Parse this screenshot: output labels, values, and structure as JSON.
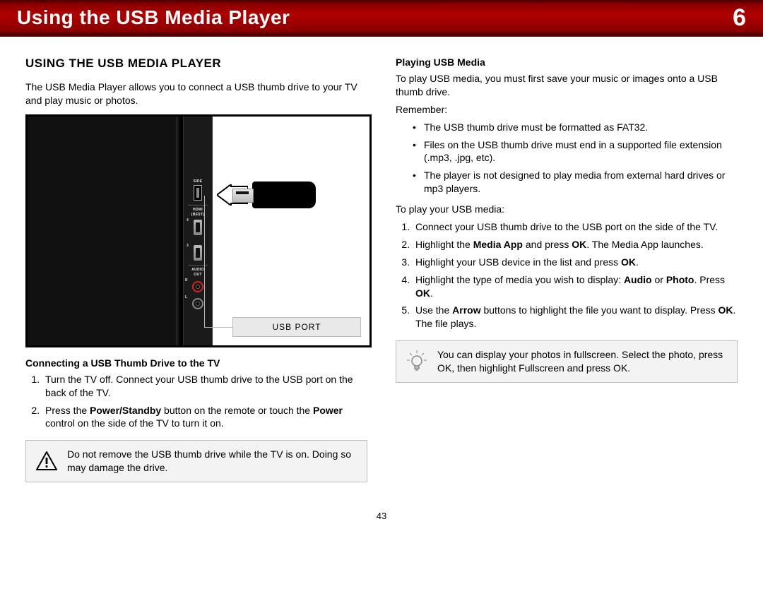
{
  "banner": {
    "title": "Using the USB Media Player",
    "chapter": "6"
  },
  "left": {
    "heading": "USING THE USB MEDIA PLAYER",
    "intro": "The USB Media Player allows you to connect a USB thumb drive to your TV and play music or photos.",
    "figure": {
      "side_label": "SIDE",
      "hdmi_label_1": "HDMI",
      "hdmi_label_2": "(BEST)",
      "audio_label_1": "AUDIO",
      "audio_label_2": "OUT",
      "port4": "4",
      "port3": "3",
      "r": "R",
      "l": "L",
      "callout_label": "USB PORT"
    },
    "sub_heading": "Connecting a USB Thumb Drive to the TV",
    "step1": "Turn the TV off. Connect your USB thumb drive to the USB port on the back of the TV.",
    "step2_a": "Press the ",
    "step2_b": "Power/Standby",
    "step2_c": " button on the remote or touch the ",
    "step2_d": "Power",
    "step2_e": " control on the side of the TV to turn it on.",
    "warning": "Do not remove the USB thumb drive while the TV is on. Doing so may damage the drive."
  },
  "right": {
    "sub_heading": "Playing USB Media",
    "intro": "To play USB media, you must first save your music or images onto a USB thumb drive.",
    "remember_label": "Remember:",
    "remember": {
      "b1": "The USB thumb drive must be formatted as FAT32.",
      "b2": "Files on the USB thumb drive must end in a supported file extension (.mp3, .jpg, etc).",
      "b3": "The player is not designed to play media from external hard drives or mp3 players."
    },
    "to_play_label": "To play your USB media:",
    "s1": "Connect your USB thumb drive to the USB port on the side of the TV.",
    "s2_a": "Highlight the ",
    "s2_b": "Media App",
    "s2_c": " and press ",
    "s2_d": "OK",
    "s2_e": ". The Media App launches.",
    "s3_a": "Highlight your USB device in the list and press ",
    "s3_b": "OK",
    "s3_c": ".",
    "s4_a": "Highlight the type of media you wish to display: ",
    "s4_b": "Audio",
    "s4_c": " or ",
    "s4_d": "Photo",
    "s4_e": ". Press ",
    "s4_f": "OK",
    "s4_g": ".",
    "s5_a": "Use the ",
    "s5_b": "Arrow",
    "s5_c": " buttons to highlight the file you want to display. Press ",
    "s5_d": "OK",
    "s5_e": ". The file plays.",
    "tip": "You can display your photos in fullscreen. Select the photo, press OK, then highlight Fullscreen and press OK."
  },
  "page_number": "43"
}
